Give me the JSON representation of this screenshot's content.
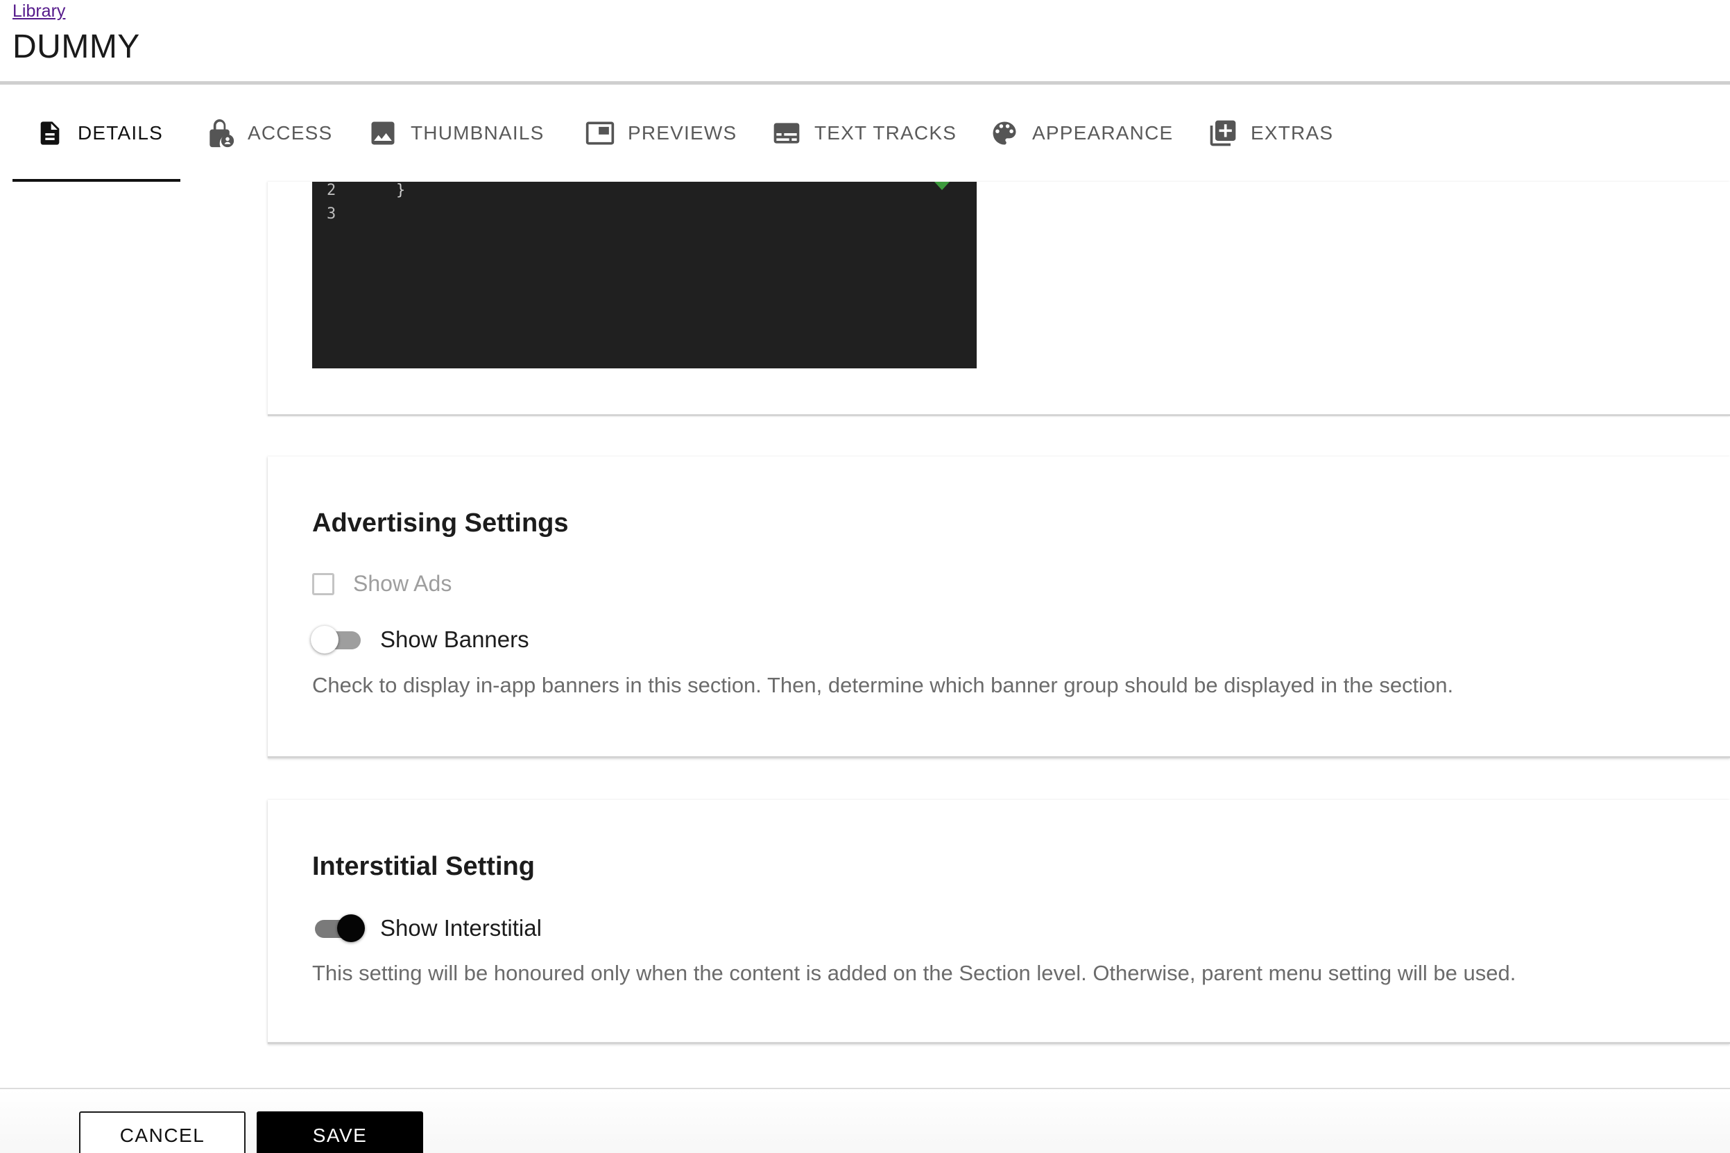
{
  "header": {
    "breadcrumb": "Library",
    "title": "DUMMY"
  },
  "tabs": [
    {
      "label": "DETAILS",
      "icon": "document-icon",
      "active": true
    },
    {
      "label": "ACCESS",
      "icon": "lock-user-icon",
      "active": false
    },
    {
      "label": "THUMBNAILS",
      "icon": "image-icon",
      "active": false
    },
    {
      "label": "PREVIEWS",
      "icon": "picture-in-picture-icon",
      "active": false
    },
    {
      "label": "TEXT TRACKS",
      "icon": "subtitles-icon",
      "active": false
    },
    {
      "label": "APPEARANCE",
      "icon": "palette-icon",
      "active": false
    },
    {
      "label": "EXTRAS",
      "icon": "library-add-icon",
      "active": false
    }
  ],
  "editor": {
    "lines": [
      {
        "number": "2",
        "text": "}"
      },
      {
        "number": "3",
        "text": ""
      }
    ],
    "marker_color": "#3c9a3c"
  },
  "advertising": {
    "title": "Advertising Settings",
    "show_ads_label": "Show Ads",
    "show_ads_checked": false,
    "show_banners_label": "Show Banners",
    "show_banners_on": false,
    "helper": "Check to display in-app banners in this section. Then, determine which banner group should be displayed in the section."
  },
  "interstitial": {
    "title": "Interstitial Setting",
    "show_interstitial_label": "Show Interstitial",
    "show_interstitial_on": true,
    "helper": "This setting will be honoured only when the content is added on the Section level. Otherwise, parent menu setting will be used."
  },
  "footer": {
    "cancel_label": "CANCEL",
    "save_label": "SAVE"
  }
}
